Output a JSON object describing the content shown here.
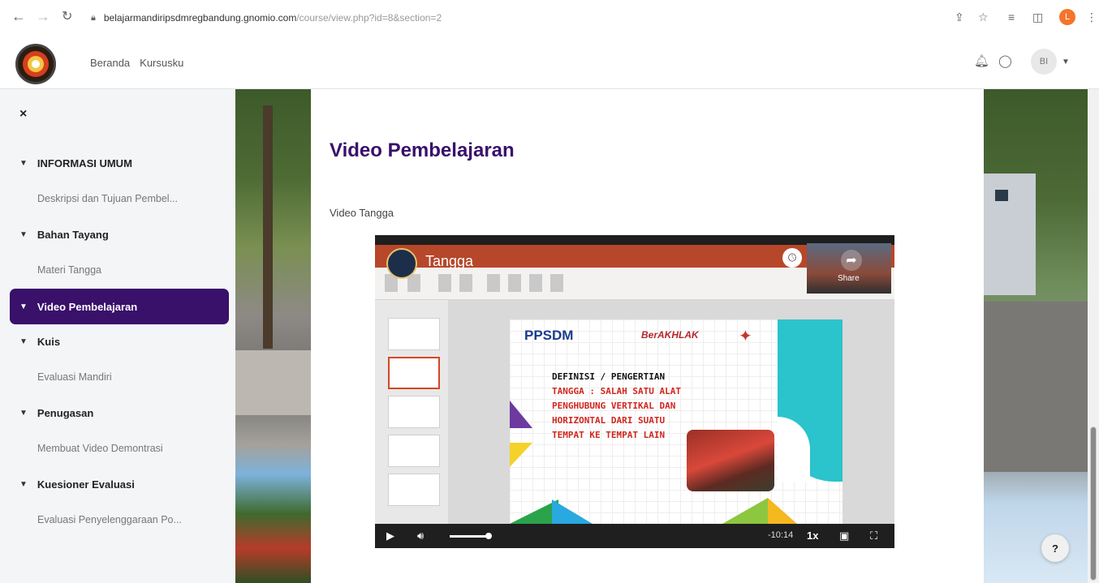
{
  "browser": {
    "url_host": "belajarmandiripsdmregbandung.gnomio.com",
    "url_path": "/course/view.php?id=8&section=2",
    "profile_initial": "L"
  },
  "header": {
    "nav": [
      "Beranda",
      "Kursusku"
    ],
    "avatar_initials": "BI"
  },
  "sidebar": {
    "close": "×",
    "sections": [
      {
        "title": "INFORMASI UMUM",
        "activity": "Deskripsi dan Tujuan Pembel..."
      },
      {
        "title": "Bahan Tayang",
        "activity": "Materi Tangga"
      },
      {
        "title": "Video Pembelajaran",
        "activity": ""
      },
      {
        "title": "Kuis",
        "activity": "Evaluasi Mandiri"
      },
      {
        "title": "Penugasan",
        "activity": "Membuat Video Demontrasi"
      },
      {
        "title": "Kuesioner Evaluasi",
        "activity": "Evaluasi Penyelenggaraan Po..."
      }
    ]
  },
  "main": {
    "title": "Video Pembelajaran",
    "label": "Video Tangga"
  },
  "video": {
    "title": "Tangga",
    "share": "Share",
    "slide": {
      "logo_left": "PPSDM",
      "logo_mid": "BerAKHLAK",
      "heading": "DEFINISI / PENGERTIAN",
      "lines": [
        "TANGGA : SALAH SATU ALAT",
        "PENGHUBUNG VERTIKAL DAN",
        "HORIZONTAL DARI SUATU",
        "TEMPAT KE TEMPAT LAIN"
      ]
    },
    "time": "-10:14",
    "speed": "1x",
    "progress_fraction": 0.22
  },
  "help": "?",
  "colors": {
    "accent": "#39106a",
    "sidebar_bg": "#f4f5f7",
    "powerpoint_red": "#b7472a"
  }
}
